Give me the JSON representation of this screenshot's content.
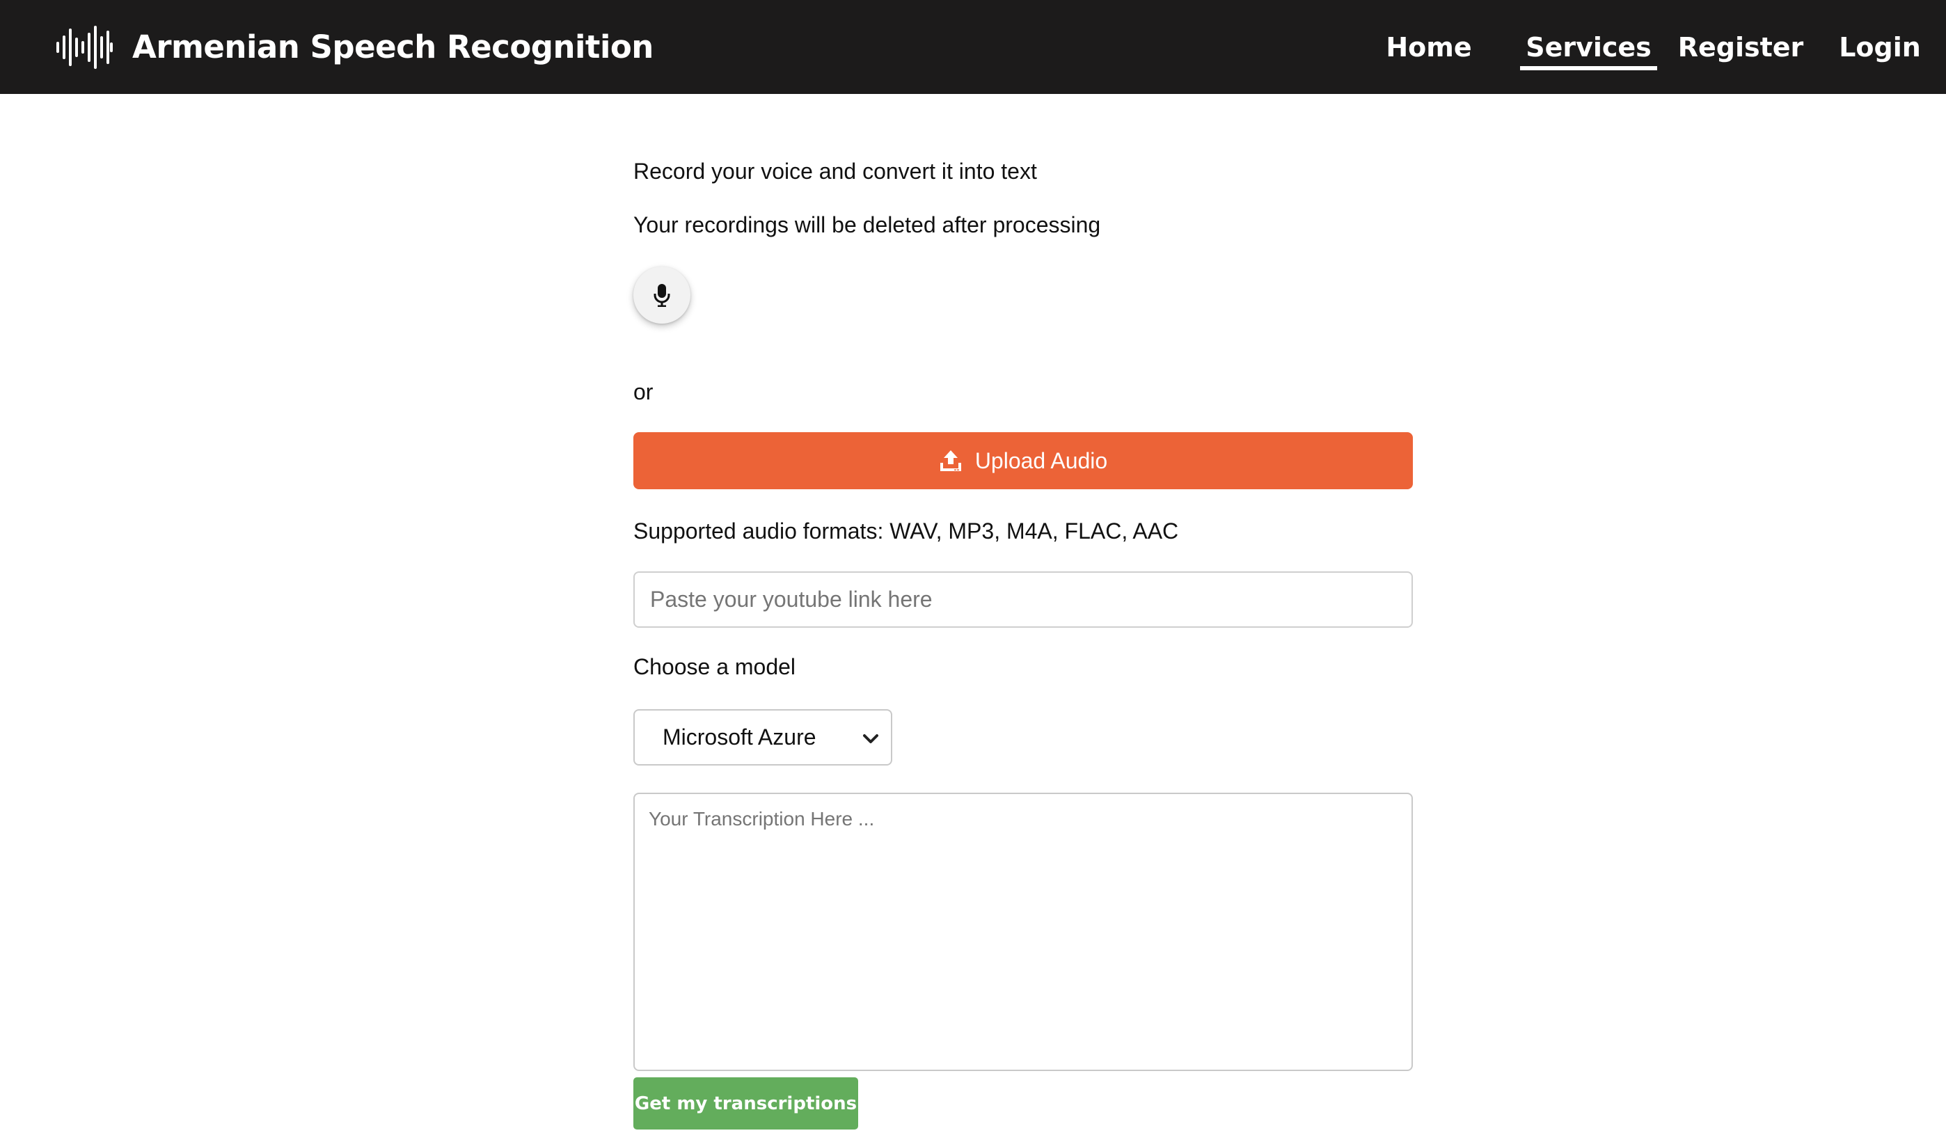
{
  "navbar": {
    "brand_title": "Armenian Speech Recognition",
    "links": [
      {
        "label": "Home",
        "active": false
      },
      {
        "label": "Services",
        "active": true
      },
      {
        "label": "Register",
        "active": false
      },
      {
        "label": "Login",
        "active": false
      }
    ]
  },
  "main": {
    "intro_line": "Record your voice and convert it into text",
    "privacy_line": "Your recordings will be deleted after processing",
    "mic_icon": "microphone-icon",
    "or_text": "or",
    "upload_button_label": "Upload Audio",
    "upload_icon": "upload-icon",
    "supported_formats": "Supported audio formats: WAV, MP3, M4A, FLAC, AAC",
    "youtube_input": {
      "value": "",
      "placeholder": "Paste your youtube link here"
    },
    "model_label": "Choose a model",
    "model_select": {
      "selected": "Microsoft Azure"
    },
    "transcription": {
      "value": "",
      "placeholder": "Your Transcription Here ..."
    },
    "submit_button_label": "Get my transcriptions"
  },
  "colors": {
    "navbar_bg": "#1c1b1b",
    "upload_button": "#ec6337",
    "submit_button": "#63ad5c"
  }
}
